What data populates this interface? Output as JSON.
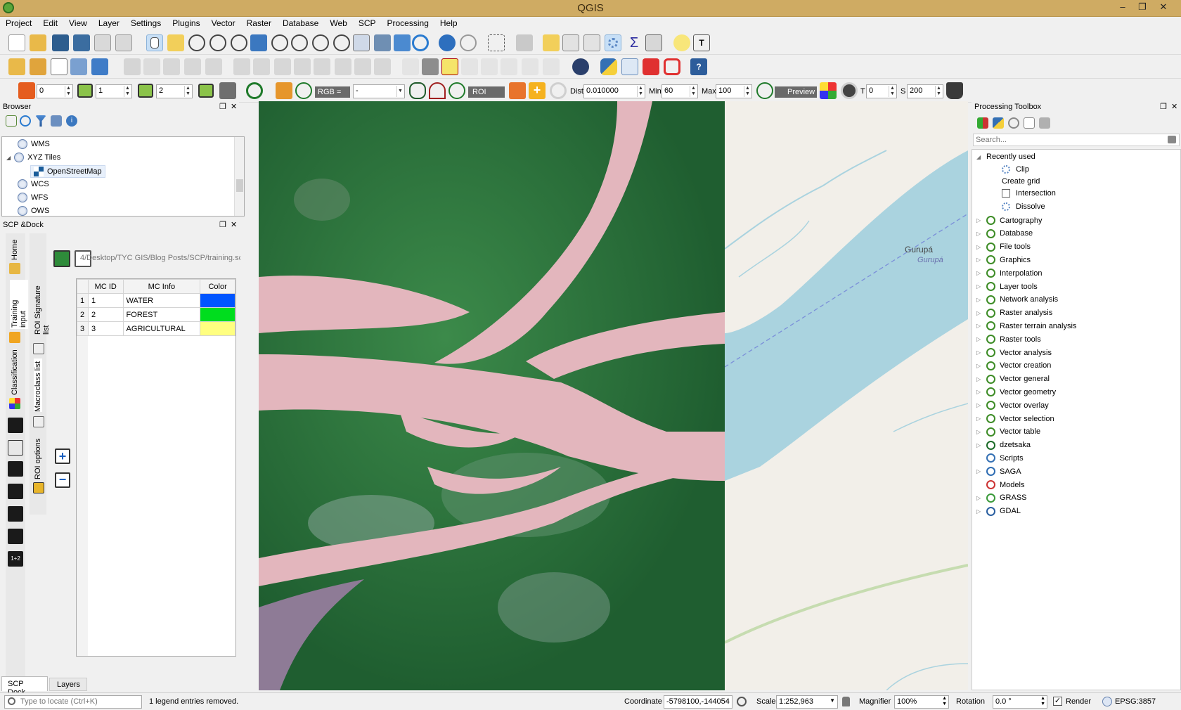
{
  "window": {
    "title": "QGIS"
  },
  "menu": [
    "Project",
    "Edit",
    "View",
    "Layer",
    "Settings",
    "Plugins",
    "Vector",
    "Raster",
    "Database",
    "Web",
    "SCP",
    "Processing",
    "Help"
  ],
  "scp_toolbar": {
    "band1": "0",
    "band2": "1",
    "band3": "2",
    "rgb_label": "RGB =",
    "rgb_value": "-",
    "roi_label": "ROI",
    "dist_label": "Dist",
    "dist_value": "0.010000",
    "min_label": "Min",
    "min_value": "60",
    "max_label": "Max",
    "max_value": "100",
    "preview_label": "Preview",
    "t_label": "T",
    "t_value": "0",
    "s_label": "S",
    "s_value": "200"
  },
  "browser": {
    "title": "Browser",
    "items": [
      {
        "label": "WMS",
        "indent": 1
      },
      {
        "label": "XYZ Tiles",
        "indent": 0
      },
      {
        "label": "OpenStreetMap",
        "indent": 2
      },
      {
        "label": "WCS",
        "indent": 1
      },
      {
        "label": "WFS",
        "indent": 1
      },
      {
        "label": "OWS",
        "indent": 1
      }
    ]
  },
  "scp_dock": {
    "title": "SCP &Dock",
    "side_tabs": [
      "Home",
      "Training input",
      "Classification"
    ],
    "inner_tabs": [
      "ROI Signature list",
      "Macroclass list",
      "ROI options"
    ],
    "path": "4/Desktop/TYC GIS/Blog Posts/SCP/training.scp",
    "table_headers": [
      "MC ID",
      "MC Info",
      "Color"
    ],
    "rows": [
      {
        "num": "1",
        "id": "1",
        "info": "WATER",
        "color": "#0055ff"
      },
      {
        "num": "2",
        "id": "2",
        "info": "FOREST",
        "color": "#00dd1e"
      },
      {
        "num": "3",
        "id": "3",
        "info": "AGRICULTURAL",
        "color": "#ffff80"
      }
    ],
    "bottom_tabs": [
      "SCP Dock",
      "Layers"
    ]
  },
  "map": {
    "place_label": "Gurupá",
    "place_label2": "Gurupá"
  },
  "toolbox": {
    "title": "Processing Toolbox",
    "search_placeholder": "Search...",
    "recent_label": "Recently used",
    "recent": [
      "Clip",
      "Create grid",
      "Intersection",
      "Dissolve"
    ],
    "groups": [
      "Cartography",
      "Database",
      "File tools",
      "Graphics",
      "Interpolation",
      "Layer tools",
      "Network analysis",
      "Raster analysis",
      "Raster terrain analysis",
      "Raster tools",
      "Vector analysis",
      "Vector creation",
      "Vector general",
      "Vector geometry",
      "Vector overlay",
      "Vector selection",
      "Vector table",
      "dzetsaka",
      "Scripts",
      "SAGA",
      "Models",
      "GRASS",
      "GDAL"
    ]
  },
  "status": {
    "locate_placeholder": "Type to locate (Ctrl+K)",
    "message": "1 legend entries removed.",
    "coord_label": "Coordinate",
    "coord_value": "-5798100,-144054",
    "scale_label": "Scale",
    "scale_value": "1:252,963",
    "magnifier_label": "Magnifier",
    "magnifier_value": "100%",
    "rotation_label": "Rotation",
    "rotation_value": "0.0 °",
    "render_label": "Render",
    "crs": "EPSG:3857"
  }
}
